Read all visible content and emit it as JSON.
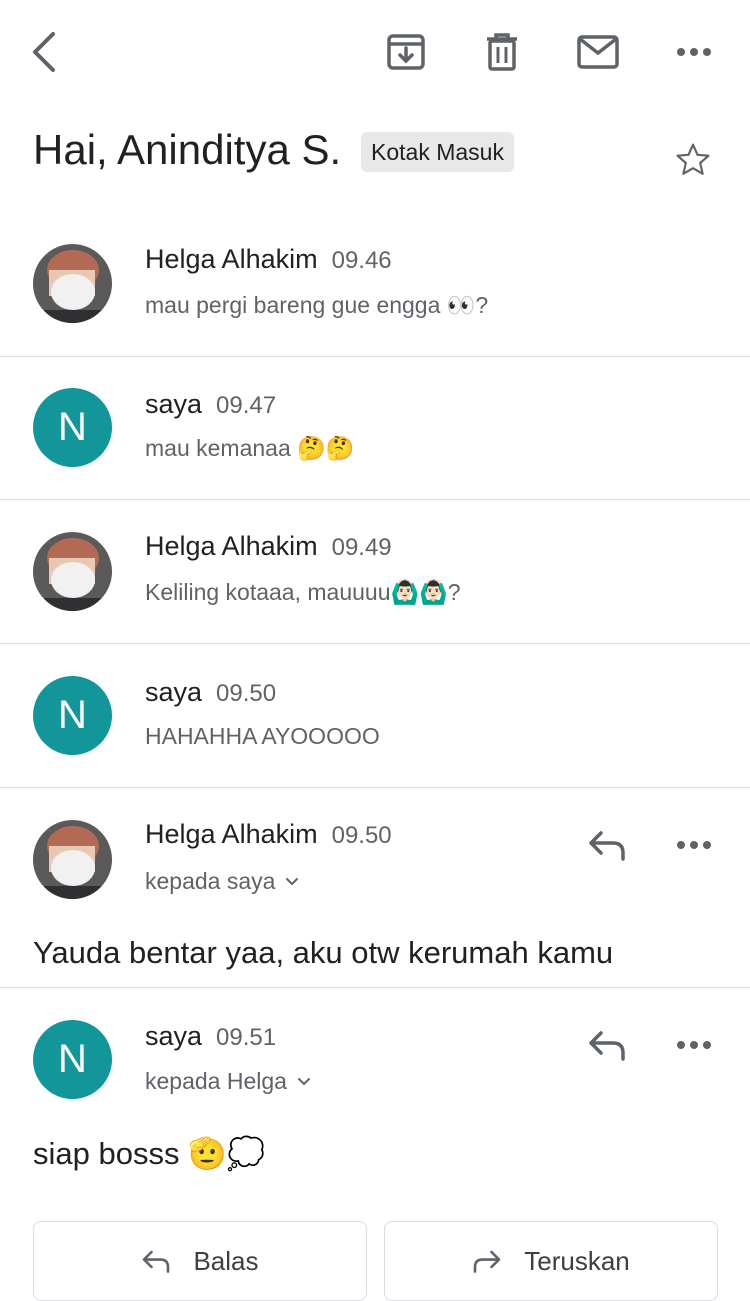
{
  "toolbar": {
    "back_icon": "back-arrow-icon",
    "archive_icon": "archive-icon",
    "delete_icon": "trash-icon",
    "unread_icon": "mail-icon",
    "more_icon": "more-horiz-icon"
  },
  "subject": {
    "title": "Hai, Aninditya S.",
    "label": "Kotak Masuk"
  },
  "colors": {
    "avatar_n": "#13969a",
    "divider": "#dadce0",
    "chip": "#e8e8e8"
  },
  "messages": [
    {
      "sender": "Helga Alhakim",
      "time": "09.46",
      "snippet": "mau pergi bareng gue engga 👀?",
      "avatar": "photo"
    },
    {
      "sender": "saya",
      "time": "09.47",
      "snippet": "mau kemanaa 🤔🤔",
      "avatar_letter": "N"
    },
    {
      "sender": "Helga Alhakim",
      "time": "09.49",
      "snippet": "Keliling kotaaa, mauuuu🙆🏻‍♂️🙆🏻‍♂️?",
      "avatar": "photo"
    },
    {
      "sender": "saya",
      "time": "09.50",
      "snippet": "HAHAHHA AYOOOOO",
      "avatar_letter": "N"
    },
    {
      "sender": "Helga Alhakim",
      "time": "09.50",
      "recipient": "kepada saya",
      "body": "Yauda bentar yaa, aku otw kerumah kamu",
      "avatar": "photo"
    },
    {
      "sender": "saya",
      "time": "09.51",
      "recipient": "kepada Helga",
      "body": "siap bosss 🫡💭",
      "avatar_letter": "N"
    }
  ],
  "actions": {
    "reply_label": "Balas",
    "forward_label": "Teruskan"
  }
}
